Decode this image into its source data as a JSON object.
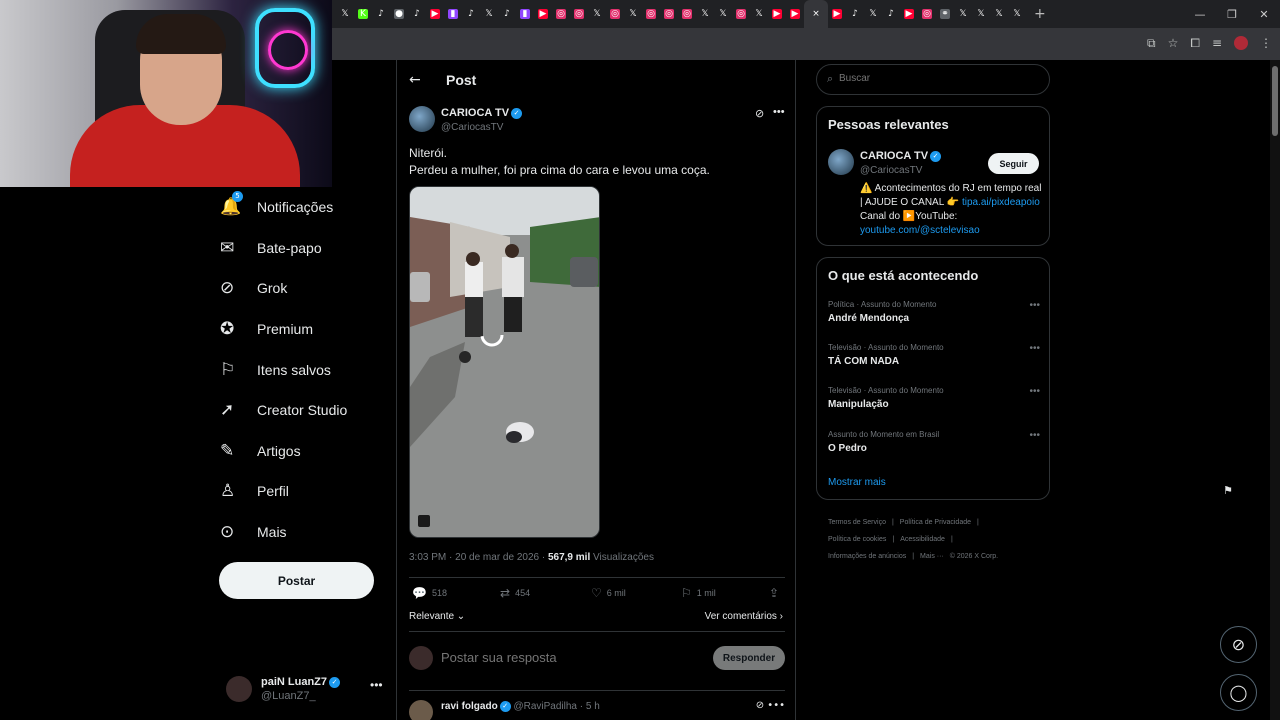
{
  "browser": {
    "tabs": [
      {
        "icon": "x-icon",
        "color": "#202124",
        "glyph": "𝕏"
      },
      {
        "icon": "kick-icon",
        "color": "#53fc18",
        "glyph": "K"
      },
      {
        "icon": "tiktok-icon",
        "color": "#202124",
        "glyph": "♪"
      },
      {
        "icon": "globe-icon",
        "color": "#5f6368",
        "glyph": "●"
      },
      {
        "icon": "tiktok-icon",
        "color": "#202124",
        "glyph": "♪"
      },
      {
        "icon": "youtube-icon",
        "color": "#ff0033",
        "glyph": "▶"
      },
      {
        "icon": "twitch-icon",
        "color": "#9146ff",
        "glyph": "▮"
      },
      {
        "icon": "tiktok-icon",
        "color": "#202124",
        "glyph": "♪"
      },
      {
        "icon": "x-icon",
        "color": "#202124",
        "glyph": "𝕏"
      },
      {
        "icon": "tiktok-icon",
        "color": "#202124",
        "glyph": "♪"
      },
      {
        "icon": "twitch-icon",
        "color": "#9146ff",
        "glyph": "▮"
      },
      {
        "icon": "youtube-icon",
        "color": "#ff0033",
        "glyph": "▶"
      },
      {
        "icon": "instagram-icon",
        "color": "#e1306c",
        "glyph": "◎"
      },
      {
        "icon": "instagram-icon",
        "color": "#e1306c",
        "glyph": "◎"
      },
      {
        "icon": "x-icon",
        "color": "#202124",
        "glyph": "𝕏"
      },
      {
        "icon": "instagram-icon",
        "color": "#e1306c",
        "glyph": "◎"
      },
      {
        "icon": "x-icon",
        "color": "#202124",
        "glyph": "𝕏"
      },
      {
        "icon": "instagram-icon",
        "color": "#e1306c",
        "glyph": "◎"
      },
      {
        "icon": "instagram-icon",
        "color": "#e1306c",
        "glyph": "◎"
      },
      {
        "icon": "instagram-icon",
        "color": "#e1306c",
        "glyph": "◎"
      },
      {
        "icon": "x-icon",
        "color": "#202124",
        "glyph": "𝕏"
      },
      {
        "icon": "x-icon",
        "color": "#202124",
        "glyph": "𝕏"
      },
      {
        "icon": "instagram-icon",
        "color": "#e1306c",
        "glyph": "◎"
      },
      {
        "icon": "x-icon",
        "color": "#202124",
        "glyph": "𝕏"
      },
      {
        "icon": "youtube-icon",
        "color": "#ff0033",
        "glyph": "▶"
      },
      {
        "icon": "youtube-icon",
        "color": "#ff0033",
        "glyph": "▶"
      },
      {
        "icon": "close-icon",
        "color": "#35363a",
        "glyph": "×",
        "active": true
      },
      {
        "icon": "youtube-icon",
        "color": "#ff0033",
        "glyph": "▶"
      },
      {
        "icon": "tiktok-icon",
        "color": "#202124",
        "glyph": "♪"
      },
      {
        "icon": "x-icon",
        "color": "#202124",
        "glyph": "𝕏"
      },
      {
        "icon": "tiktok-icon",
        "color": "#202124",
        "glyph": "♪"
      },
      {
        "icon": "youtube-icon",
        "color": "#ff0033",
        "glyph": "▶"
      },
      {
        "icon": "instagram-icon",
        "color": "#e1306c",
        "glyph": "◎"
      },
      {
        "icon": "link-icon",
        "color": "#5f6368",
        "glyph": "⚭"
      },
      {
        "icon": "x-icon",
        "color": "#202124",
        "glyph": "𝕏"
      },
      {
        "icon": "x-icon",
        "color": "#202124",
        "glyph": "𝕏"
      },
      {
        "icon": "x-icon",
        "color": "#202124",
        "glyph": "𝕏"
      },
      {
        "icon": "x-icon",
        "color": "#202124",
        "glyph": "𝕏"
      }
    ],
    "new_tab": "+",
    "window_controls": [
      "—",
      "❐",
      "✕"
    ]
  },
  "nav": {
    "items": [
      {
        "icon": "bell-icon",
        "glyph": "🔔",
        "label": "Notificações",
        "badge": "5"
      },
      {
        "icon": "envelope-icon",
        "glyph": "✉",
        "label": "Bate-papo"
      },
      {
        "icon": "grok-icon",
        "glyph": "⊘",
        "label": "Grok"
      },
      {
        "icon": "premium-icon",
        "glyph": "✪",
        "label": "Premium"
      },
      {
        "icon": "bookmark-icon",
        "glyph": "⚐",
        "label": "Itens salvos"
      },
      {
        "icon": "rocket-icon",
        "glyph": "➚",
        "label": "Creator Studio"
      },
      {
        "icon": "article-icon",
        "glyph": "✎",
        "label": "Artigos"
      },
      {
        "icon": "person-icon",
        "glyph": "♙",
        "label": "Perfil"
      },
      {
        "icon": "more-icon",
        "glyph": "⊙",
        "label": "Mais"
      }
    ],
    "post_button": "Postar",
    "account": {
      "name": "paiN LuanZ7",
      "handle": "@LuanZ7_",
      "more": "•••"
    }
  },
  "post": {
    "header_title": "Post",
    "author_name": "CARIOCA TV",
    "author_handle": "@CariocasTV",
    "more": "•••",
    "text_line1": "Niterói.",
    "text_line2": "Perdeu a mulher, foi pra cima do cara e levou uma coça.",
    "timestamp": "3:03 PM · 20 de mar de 2026 · ",
    "views_count": "567,9 mil",
    "views_label": " Visualizações",
    "replies": "518",
    "reposts": "454",
    "likes": "6 mil",
    "bookmarks": "1 mil",
    "sort_label": "Relevante",
    "view_comments": "Ver comentários",
    "reply_placeholder": "Postar sua resposta",
    "reply_button": "Responder",
    "comment": {
      "name": "ravi folgado",
      "handle": "@RaviPadilha · 5 h",
      "more": "•••"
    }
  },
  "search": {
    "placeholder": "Buscar"
  },
  "relevant": {
    "title": "Pessoas relevantes",
    "name": "CARIOCA TV",
    "handle": "@CariocasTV",
    "follow_button": "Seguir",
    "bio_line1": "⚠️ Acontecimentos do RJ em tempo real | AJUDE O CANAL 👉",
    "bio_link1": "tipa.ai/pixdeapoio",
    "bio_mid": " Canal do ▶️YouTube:",
    "bio_link2": "youtube.com/@sctelevisao"
  },
  "trends": {
    "title": "O que está acontecendo",
    "items": [
      {
        "context": "Política · Assunto do Momento",
        "name": "André Mendonça"
      },
      {
        "context": "Televisão · Assunto do Momento",
        "name": "TÁ COM NADA"
      },
      {
        "context": "Televisão · Assunto do Momento",
        "name": "Manipulação"
      },
      {
        "context": "Assunto do Momento em Brasil",
        "name": "O Pedro"
      }
    ],
    "more_glyph": "•••",
    "show_more": "Mostrar mais"
  },
  "footer": {
    "links": [
      "Termos de Serviço",
      "|",
      "Política de Privacidade",
      "|",
      "Política de cookies",
      "|",
      "Acessibilidade",
      "|",
      "Informações de anúncios",
      "|",
      "Mais ···",
      "© 2026 X Corp."
    ]
  },
  "colors": {
    "accent": "#1d9bf0",
    "background": "#000000",
    "border": "#2f3336",
    "muted": "#71767b"
  }
}
